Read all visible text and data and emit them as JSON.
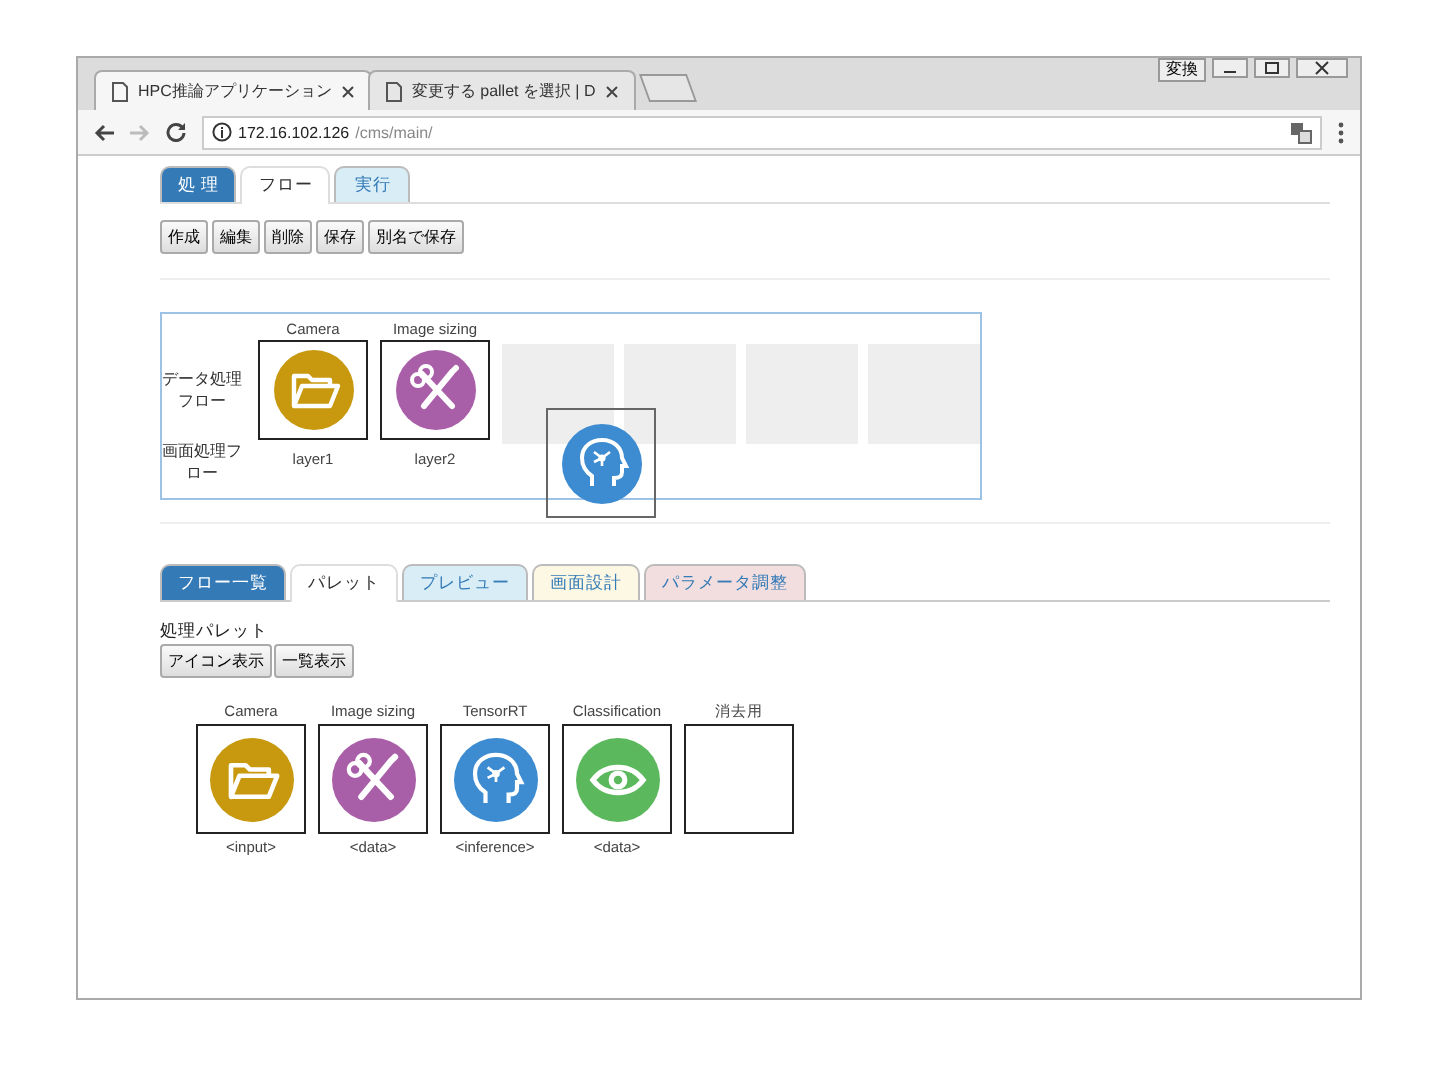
{
  "browser": {
    "tabs": [
      {
        "title": "HPC推論アプリケーション",
        "selected": true
      },
      {
        "title": "変更する pallet を選択 | D",
        "selected": false
      }
    ],
    "control_label": "変換",
    "address": {
      "host": "172.16.102.126",
      "path": "/cms/main/"
    }
  },
  "top_tabs": [
    {
      "label": "処 理",
      "selected": false,
      "color": "#337ab7"
    },
    {
      "label": "フロー",
      "selected": true,
      "color": "#ffffff"
    },
    {
      "label": "実行",
      "selected": false,
      "color": "#d9edf7"
    }
  ],
  "actions": [
    "作成",
    "編集",
    "削除",
    "保存",
    "別名で保存"
  ],
  "flow": {
    "row_labels": [
      "データ処理フロー",
      "画面処理フロー"
    ],
    "cells": [
      {
        "kind": "folder",
        "title": "Camera",
        "layer": "layer1"
      },
      {
        "kind": "tools",
        "title": "Image sizing",
        "layer": "layer2"
      },
      {
        "kind": "empty"
      },
      {
        "kind": "empty"
      },
      {
        "kind": "empty"
      },
      {
        "kind": "empty"
      }
    ],
    "dragging": {
      "kind": "head"
    }
  },
  "bottom_tabs": [
    {
      "label": "フロー一覧",
      "selected": false,
      "color": "#337ab7"
    },
    {
      "label": "パレット",
      "selected": true,
      "color": "#ffffff"
    },
    {
      "label": "プレビュー",
      "selected": false,
      "color": "#d9edf7"
    },
    {
      "label": "画面設計",
      "selected": false,
      "color": "#fcf8e3"
    },
    {
      "label": "パラメータ調整",
      "selected": false,
      "color": "#f2dede"
    }
  ],
  "palette": {
    "title": "処理パレット",
    "view_buttons": [
      "アイコン表示",
      "一覧表示"
    ],
    "items": [
      {
        "kind": "folder",
        "title": "Camera",
        "type": "<input>"
      },
      {
        "kind": "tools",
        "title": "Image sizing",
        "type": "<data>"
      },
      {
        "kind": "head",
        "title": "TensorRT",
        "type": "<inference>"
      },
      {
        "kind": "eye",
        "title": "Classification",
        "type": "<data>"
      },
      {
        "kind": "blank",
        "title": "消去用"
      }
    ]
  }
}
